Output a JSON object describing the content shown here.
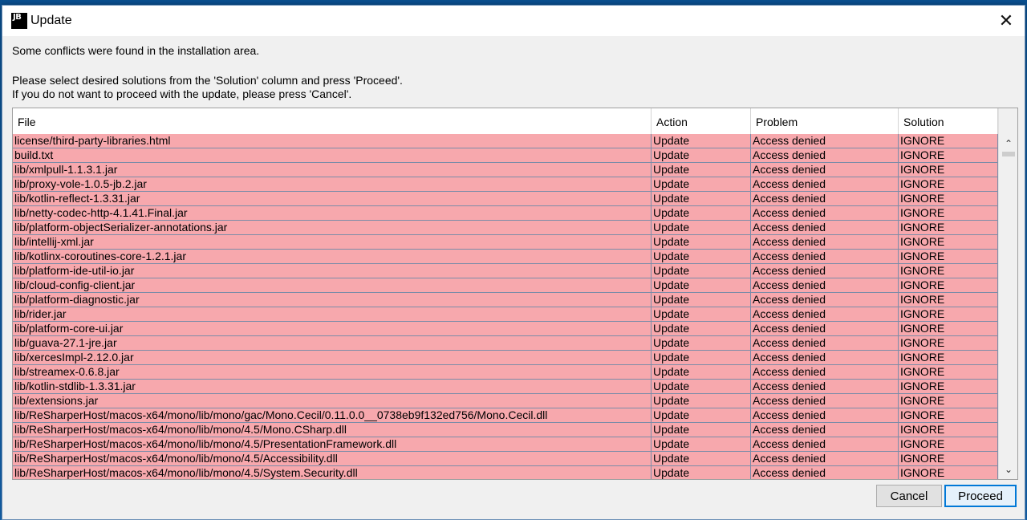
{
  "window": {
    "app_icon": "JB",
    "title": "Update",
    "close_label": "✕"
  },
  "messages": {
    "line1": "Some conflicts were found in the installation area.",
    "line2": "Please select desired solutions from the 'Solution' column and press 'Proceed'.",
    "line3": "If you do not want to proceed with the update, please press 'Cancel'."
  },
  "table": {
    "columns": [
      "File",
      "Action",
      "Problem",
      "Solution"
    ],
    "row_color": "#f7a8ad",
    "rows": [
      [
        "license/third-party-libraries.html",
        "Update",
        "Access denied",
        "IGNORE"
      ],
      [
        "build.txt",
        "Update",
        "Access denied",
        "IGNORE"
      ],
      [
        "lib/xmlpull-1.1.3.1.jar",
        "Update",
        "Access denied",
        "IGNORE"
      ],
      [
        "lib/proxy-vole-1.0.5-jb.2.jar",
        "Update",
        "Access denied",
        "IGNORE"
      ],
      [
        "lib/kotlin-reflect-1.3.31.jar",
        "Update",
        "Access denied",
        "IGNORE"
      ],
      [
        "lib/netty-codec-http-4.1.41.Final.jar",
        "Update",
        "Access denied",
        "IGNORE"
      ],
      [
        "lib/platform-objectSerializer-annotations.jar",
        "Update",
        "Access denied",
        "IGNORE"
      ],
      [
        "lib/intellij-xml.jar",
        "Update",
        "Access denied",
        "IGNORE"
      ],
      [
        "lib/kotlinx-coroutines-core-1.2.1.jar",
        "Update",
        "Access denied",
        "IGNORE"
      ],
      [
        "lib/platform-ide-util-io.jar",
        "Update",
        "Access denied",
        "IGNORE"
      ],
      [
        "lib/cloud-config-client.jar",
        "Update",
        "Access denied",
        "IGNORE"
      ],
      [
        "lib/platform-diagnostic.jar",
        "Update",
        "Access denied",
        "IGNORE"
      ],
      [
        "lib/rider.jar",
        "Update",
        "Access denied",
        "IGNORE"
      ],
      [
        "lib/platform-core-ui.jar",
        "Update",
        "Access denied",
        "IGNORE"
      ],
      [
        "lib/guava-27.1-jre.jar",
        "Update",
        "Access denied",
        "IGNORE"
      ],
      [
        "lib/xercesImpl-2.12.0.jar",
        "Update",
        "Access denied",
        "IGNORE"
      ],
      [
        "lib/streamex-0.6.8.jar",
        "Update",
        "Access denied",
        "IGNORE"
      ],
      [
        "lib/kotlin-stdlib-1.3.31.jar",
        "Update",
        "Access denied",
        "IGNORE"
      ],
      [
        "lib/extensions.jar",
        "Update",
        "Access denied",
        "IGNORE"
      ],
      [
        "lib/ReSharperHost/macos-x64/mono/lib/mono/gac/Mono.Cecil/0.11.0.0__0738eb9f132ed756/Mono.Cecil.dll",
        "Update",
        "Access denied",
        "IGNORE"
      ],
      [
        "lib/ReSharperHost/macos-x64/mono/lib/mono/4.5/Mono.CSharp.dll",
        "Update",
        "Access denied",
        "IGNORE"
      ],
      [
        "lib/ReSharperHost/macos-x64/mono/lib/mono/4.5/PresentationFramework.dll",
        "Update",
        "Access denied",
        "IGNORE"
      ],
      [
        "lib/ReSharperHost/macos-x64/mono/lib/mono/4.5/Accessibility.dll",
        "Update",
        "Access denied",
        "IGNORE"
      ],
      [
        "lib/ReSharperHost/macos-x64/mono/lib/mono/4.5/System.Security.dll",
        "Update",
        "Access denied",
        "IGNORE"
      ]
    ]
  },
  "scrollbar": {
    "up_icon": "⌃",
    "down_icon": "⌄"
  },
  "buttons": {
    "cancel": "Cancel",
    "proceed": "Proceed"
  }
}
